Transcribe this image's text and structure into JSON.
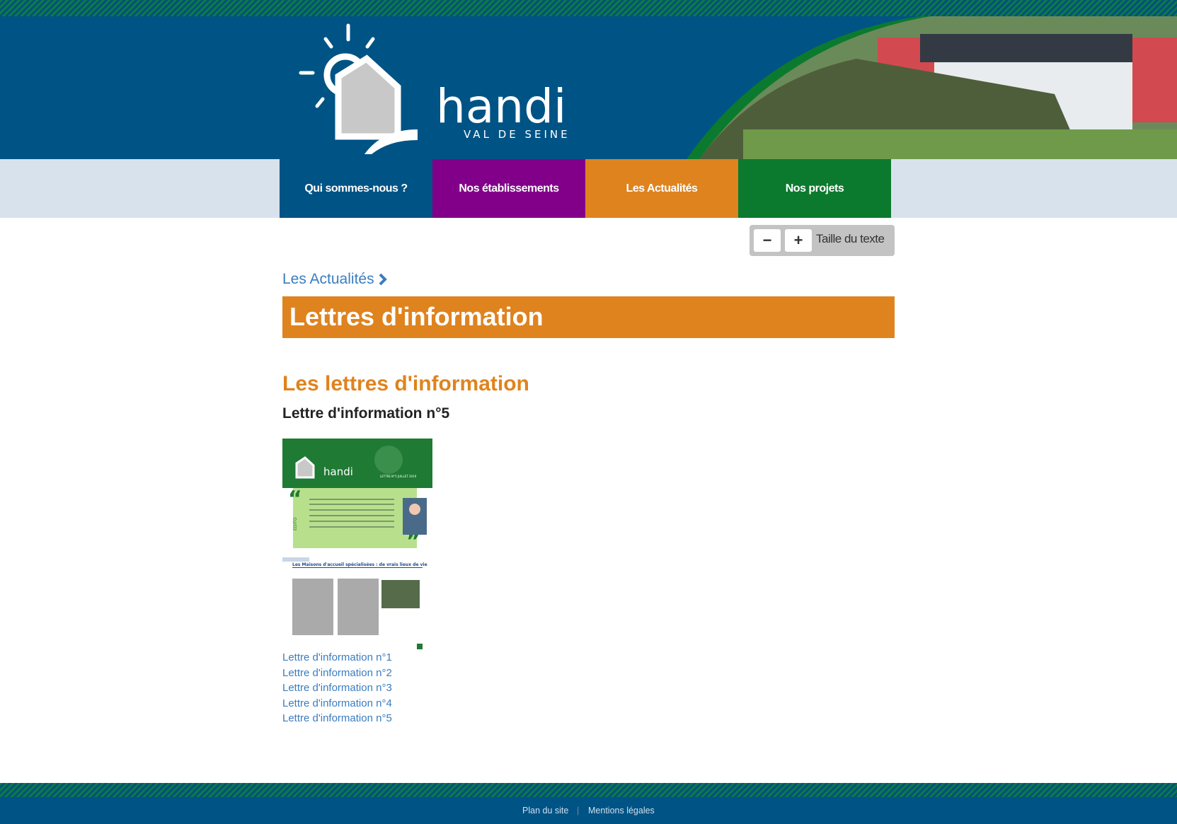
{
  "header": {
    "logo_text": "handi",
    "logo_subtext": "VAL DE SEINE"
  },
  "nav": [
    {
      "label": "Qui sommes-nous ?",
      "color": "#005385"
    },
    {
      "label": "Nos établissements",
      "color": "#820089"
    },
    {
      "label": "Les Actualités",
      "color": "#df831e"
    },
    {
      "label": "Nos projets",
      "color": "#0b7a2e"
    }
  ],
  "text_size": {
    "decrease": "−",
    "increase": "+",
    "label": "Taille du texte"
  },
  "breadcrumb": {
    "label": "Les Actualités"
  },
  "page_title": "Lettres d'information",
  "section_title": "Les lettres d'information",
  "sub_title": "Lettre d'information n°5",
  "thumbnail": {
    "logo_text": "handi",
    "edition": "LETTRE N°5 JUILLET 2019",
    "edito": "EDITO",
    "headline": "Les Maisons d'accueil spécialisées : de vrais lieux de vie"
  },
  "links": [
    "Lettre d'information n°1",
    "Lettre d'information n°2",
    "Lettre d'information n°3",
    "Lettre d'information n°4",
    "Lettre d'information n°5"
  ],
  "footer": {
    "sitemap": "Plan du site",
    "separator": "|",
    "legal": "Mentions légales"
  }
}
